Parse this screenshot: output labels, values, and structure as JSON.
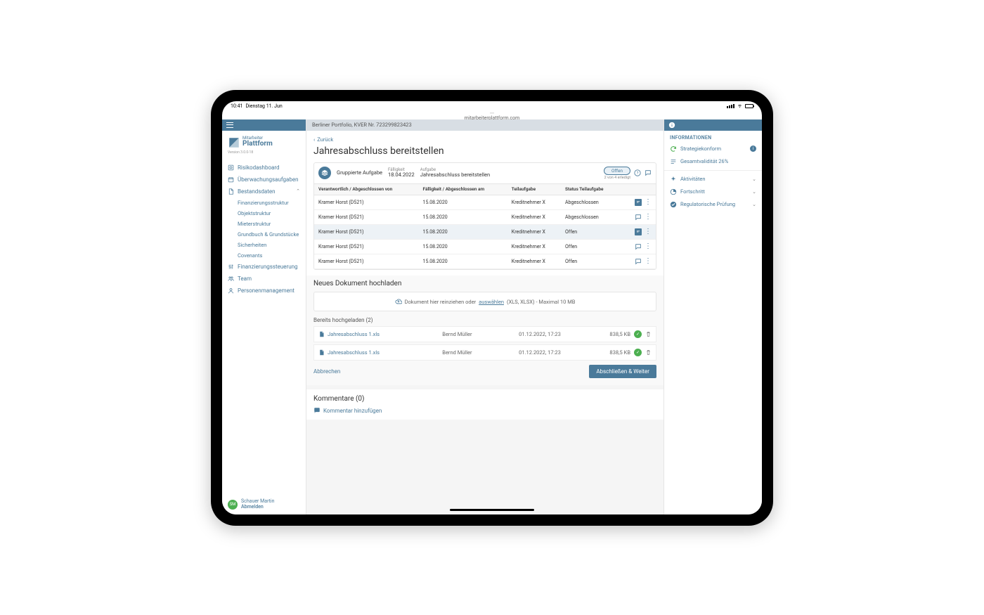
{
  "status_bar": {
    "time": "10:41",
    "date": "Dienstag 11. Jun"
  },
  "url": "mitarbeiterplattform.com",
  "brand": {
    "small": "Mitarbeiter",
    "large": "Plattform",
    "version": "Version 3.0.0-18"
  },
  "nav": {
    "items": [
      {
        "label": "Risikodashboard",
        "icon": "gauge"
      },
      {
        "label": "Überwachungsaufgaben",
        "icon": "calendar"
      },
      {
        "label": "Bestandsdaten",
        "icon": "doc",
        "expanded": true,
        "children": [
          "Finanzierungsstruktur",
          "Objektstruktur",
          "Mieterstruktur",
          "Grundbuch & Grundstücke",
          "Sicherheiten",
          "Covenants"
        ]
      },
      {
        "label": "Finanzierungssteuerung",
        "icon": "sliders"
      },
      {
        "label": "Team",
        "icon": "people"
      },
      {
        "label": "Personenmanagement",
        "icon": "person"
      }
    ]
  },
  "user": {
    "initials": "SM",
    "name": "Schauer Martin",
    "logout": "Abmelden"
  },
  "header": {
    "breadcrumb": "Berliner Portfolio, KVER Nr. 723299823423"
  },
  "page": {
    "back": "Zurück",
    "title": "Jahresabschluss bereitstellen"
  },
  "task": {
    "group_label": "Gruppierte Aufgabe",
    "due_label": "Fälligkeit",
    "due_value": "18.04.2022",
    "task_label": "Aufgabe",
    "task_value": "Jahresabschluss bereitstellen",
    "status_pill": "Offen",
    "progress": "2 von 4 erledigt",
    "columns": {
      "owner": "Verantwortlich / Abgeschlossen von",
      "due": "Fälligkeit / Abgeschlossen am",
      "sub": "Teilaufgabe",
      "status": "Status Teilaufgabe"
    },
    "rows": [
      {
        "owner": "Kramer Horst (D521)",
        "due": "15.08.2020",
        "sub": "Kreditnehmer X",
        "status": "Abgeschlossen",
        "filled": true
      },
      {
        "owner": "Kramer Horst (D521)",
        "due": "15.08.2020",
        "sub": "Kreditnehmer X",
        "status": "Abgeschlossen",
        "filled": false
      },
      {
        "owner": "Kramer Horst (D521)",
        "due": "15.08.2020",
        "sub": "Kreditnehmer X",
        "status": "Offen",
        "filled": true,
        "selected": true
      },
      {
        "owner": "Kramer Horst (D521)",
        "due": "15.08.2020",
        "sub": "Kreditnehmer X",
        "status": "Offen",
        "filled": false
      },
      {
        "owner": "Kramer Horst (D521)",
        "due": "15.08.2020",
        "sub": "Kreditnehmer X",
        "status": "Offen",
        "filled": false
      }
    ]
  },
  "upload": {
    "title": "Neues Dokument hochladen",
    "hint_pre": "Dokument hier reinziehen oder ",
    "hint_link": "auswählen",
    "hint_post": " (XLS, XLSX) - Maximal 10 MB",
    "list_title": "Bereits hochgeladen (2)",
    "files": [
      {
        "name": "Jahresabschluss 1.xls",
        "user": "Bernd Müller",
        "date": "01.12.2022, 17:23",
        "size": "838,5 KB"
      },
      {
        "name": "Jahresabschluss 1.xls",
        "user": "Bernd Müller",
        "date": "01.12.2022, 17:23",
        "size": "838,5 KB"
      }
    ],
    "cancel": "Abbrechen",
    "submit": "Abschließen & Weiter"
  },
  "comments": {
    "title": "Kommentare (0)",
    "add": "Kommentar hinzufügen"
  },
  "rightbar": {
    "info_title": "INFORMATIONEN",
    "info_items": [
      {
        "label": "Strategiekonform",
        "icon": "refresh",
        "info": true
      },
      {
        "label": "Gesamtvalidität 26%",
        "icon": "lines"
      }
    ],
    "accordion": [
      {
        "label": "Aktivitäten",
        "icon": "spark"
      },
      {
        "label": "Fortschritt",
        "icon": "pie"
      },
      {
        "label": "Regulatorische Prüfung",
        "icon": "check"
      }
    ]
  }
}
